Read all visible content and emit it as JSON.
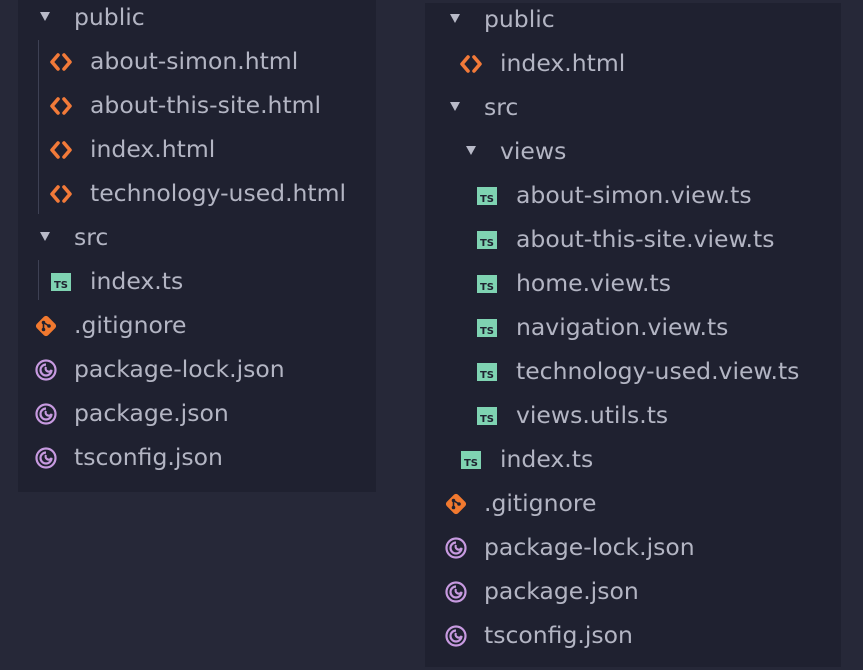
{
  "colors": {
    "background": "#262838",
    "panel": "#1f2130",
    "text": "#b3b5c3",
    "html_icon": "#f27a39",
    "ts_icon": "#7fd3b2",
    "git_icon": "#f1792f",
    "npm_icon": "#c79ae0"
  },
  "left_tree": {
    "items": [
      {
        "label": "public",
        "kind": "folder",
        "icon": "expanded-arrow"
      },
      {
        "label": "about-simon.html",
        "kind": "file",
        "icon": "html-icon"
      },
      {
        "label": "about-this-site.html",
        "kind": "file",
        "icon": "html-icon"
      },
      {
        "label": "index.html",
        "kind": "file",
        "icon": "html-icon"
      },
      {
        "label": "technology-used.html",
        "kind": "file",
        "icon": "html-icon"
      },
      {
        "label": "src",
        "kind": "folder",
        "icon": "expanded-arrow"
      },
      {
        "label": "index.ts",
        "kind": "file",
        "icon": "ts-icon"
      },
      {
        "label": ".gitignore",
        "kind": "file",
        "icon": "git-icon"
      },
      {
        "label": "package-lock.json",
        "kind": "file",
        "icon": "npm-icon"
      },
      {
        "label": "package.json",
        "kind": "file",
        "icon": "npm-icon"
      },
      {
        "label": "tsconfig.json",
        "kind": "file",
        "icon": "npm-icon"
      }
    ]
  },
  "right_tree": {
    "items": [
      {
        "label": "public",
        "kind": "folder",
        "icon": "expanded-arrow"
      },
      {
        "label": "index.html",
        "kind": "file",
        "icon": "html-icon"
      },
      {
        "label": "src",
        "kind": "folder",
        "icon": "expanded-arrow"
      },
      {
        "label": "views",
        "kind": "folder",
        "icon": "expanded-arrow"
      },
      {
        "label": "about-simon.view.ts",
        "kind": "file",
        "icon": "ts-icon"
      },
      {
        "label": "about-this-site.view.ts",
        "kind": "file",
        "icon": "ts-icon"
      },
      {
        "label": "home.view.ts",
        "kind": "file",
        "icon": "ts-icon"
      },
      {
        "label": "navigation.view.ts",
        "kind": "file",
        "icon": "ts-icon"
      },
      {
        "label": "technology-used.view.ts",
        "kind": "file",
        "icon": "ts-icon"
      },
      {
        "label": "views.utils.ts",
        "kind": "file",
        "icon": "ts-icon"
      },
      {
        "label": "index.ts",
        "kind": "file",
        "icon": "ts-icon"
      },
      {
        "label": ".gitignore",
        "kind": "file",
        "icon": "git-icon"
      },
      {
        "label": "package-lock.json",
        "kind": "file",
        "icon": "npm-icon"
      },
      {
        "label": "package.json",
        "kind": "file",
        "icon": "npm-icon"
      },
      {
        "label": "tsconfig.json",
        "kind": "file",
        "icon": "npm-icon"
      }
    ]
  }
}
